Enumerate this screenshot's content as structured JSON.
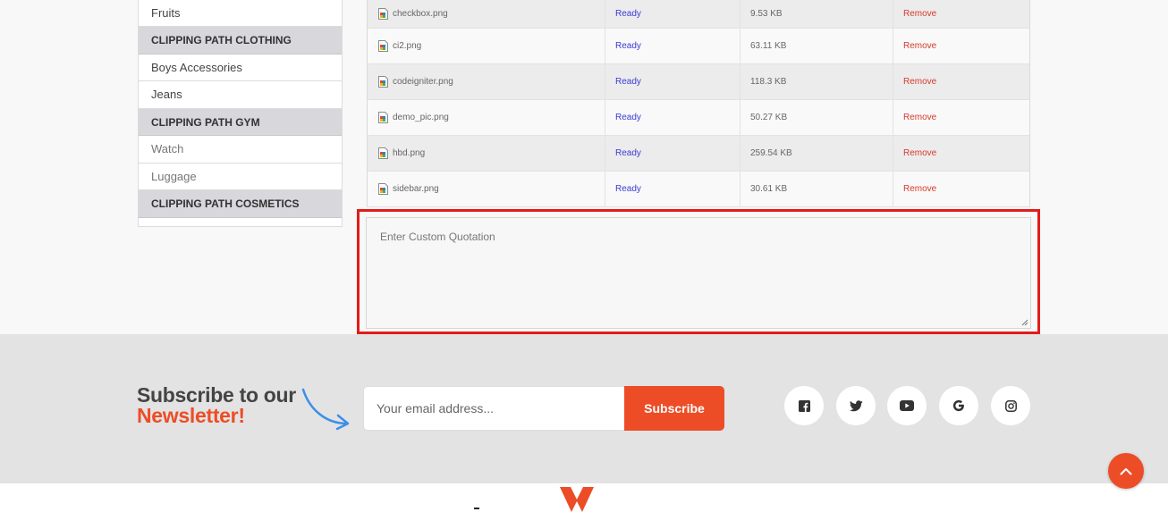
{
  "sidebar": {
    "items": [
      {
        "type": "item",
        "label": "Fruits"
      },
      {
        "type": "head",
        "label": "CLIPPING PATH CLOTHING"
      },
      {
        "type": "item",
        "label": "Boys Accessories"
      },
      {
        "type": "item",
        "label": "Jeans"
      },
      {
        "type": "head",
        "label": "CLIPPING PATH GYM"
      },
      {
        "type": "item",
        "label": "Watch"
      },
      {
        "type": "item",
        "label": "Luggage"
      },
      {
        "type": "head",
        "label": "CLIPPING PATH COSMETICS"
      }
    ]
  },
  "files": [
    {
      "name": "checkbox.png",
      "status": "Ready",
      "size": "9.53 KB",
      "action": "Remove"
    },
    {
      "name": "ci2.png",
      "status": "Ready",
      "size": "63.11 KB",
      "action": "Remove"
    },
    {
      "name": "codeigniter.png",
      "status": "Ready",
      "size": "118.3 KB",
      "action": "Remove"
    },
    {
      "name": "demo_pic.png",
      "status": "Ready",
      "size": "50.27 KB",
      "action": "Remove"
    },
    {
      "name": "hbd.png",
      "status": "Ready",
      "size": "259.54 KB",
      "action": "Remove"
    },
    {
      "name": "sidebar.png",
      "status": "Ready",
      "size": "30.61 KB",
      "action": "Remove"
    }
  ],
  "quotation": {
    "placeholder": "Enter Custom Quotation"
  },
  "newsletter": {
    "title_line1": "Subscribe to our",
    "title_line2": "Newsletter!",
    "email_placeholder": "Your email address...",
    "button_label": "Subscribe"
  },
  "social": [
    "facebook-icon",
    "twitter-icon",
    "youtube-icon",
    "google-icon",
    "instagram-icon"
  ],
  "colors": {
    "accent": "#ec4d27",
    "ready": "#3a3ad6",
    "remove": "#d63a2a",
    "highlight": "#e31b1b"
  }
}
